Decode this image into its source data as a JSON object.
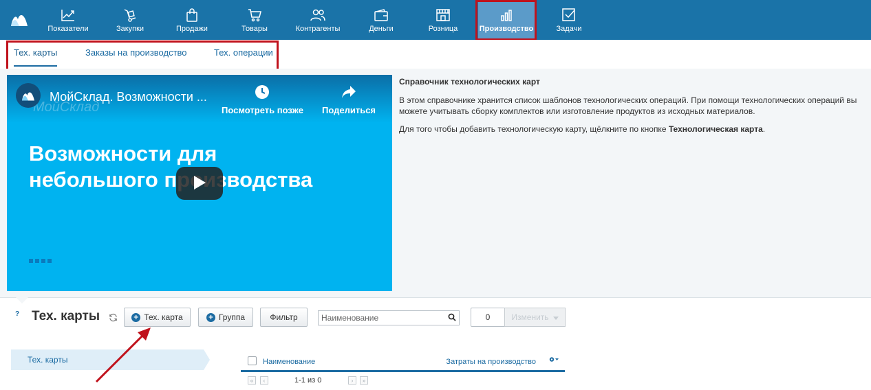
{
  "colors": {
    "nav_bg": "#1a73a8",
    "nav_active_bg": "#5b9bc9",
    "accent": "#1b6ba2",
    "video_bg": "#00b3f0",
    "highlight": "#c0121c"
  },
  "nav": {
    "items": [
      {
        "label": "Показатели",
        "icon": "chart-line-icon"
      },
      {
        "label": "Закупки",
        "icon": "cart-dolly-icon"
      },
      {
        "label": "Продажи",
        "icon": "shopping-bag-icon"
      },
      {
        "label": "Товары",
        "icon": "shopping-cart-icon"
      },
      {
        "label": "Контрагенты",
        "icon": "users-icon"
      },
      {
        "label": "Деньги",
        "icon": "wallet-icon"
      },
      {
        "label": "Розница",
        "icon": "storefront-icon"
      },
      {
        "label": "Производство",
        "icon": "bar-chart-icon",
        "active": true
      },
      {
        "label": "Задачи",
        "icon": "task-check-icon"
      }
    ]
  },
  "subnav": {
    "tabs": [
      {
        "label": "Тех. карты",
        "active": true
      },
      {
        "label": "Заказы на производство"
      },
      {
        "label": "Тех. операции"
      }
    ]
  },
  "video": {
    "title": "МойСклад. Возможности ...",
    "watermark": "МойСклад",
    "watch_later": "Посмотреть позже",
    "share": "Поделиться",
    "headline_line1": "Возможности для",
    "headline_line2": "небольшого производства"
  },
  "info": {
    "title": "Справочник технологических карт",
    "para1": "В этом справочнике хранится список шаблонов технологических операций. При помощи технологических операций вы можете учитывать сборку комплектов или изготовление продуктов из исходных материалов.",
    "para2_prefix": "Для того чтобы добавить технологическую карту, щёлкните по кнопке ",
    "para2_bold": "Технологическая карта",
    "para2_suffix": "."
  },
  "toolbar": {
    "help": "?",
    "page_title": "Тех. карты",
    "add_card_label": "Тех. карта",
    "add_group_label": "Группа",
    "filter_label": "Фильтр",
    "search_placeholder": "Наименование",
    "selected_count": "0",
    "change_label": "Изменить"
  },
  "folders": {
    "root_label": "Тех. карты"
  },
  "table": {
    "columns": {
      "name": "Наименование",
      "cost": "Затраты на производство"
    },
    "pager": {
      "range": "1-1 из 0"
    }
  }
}
